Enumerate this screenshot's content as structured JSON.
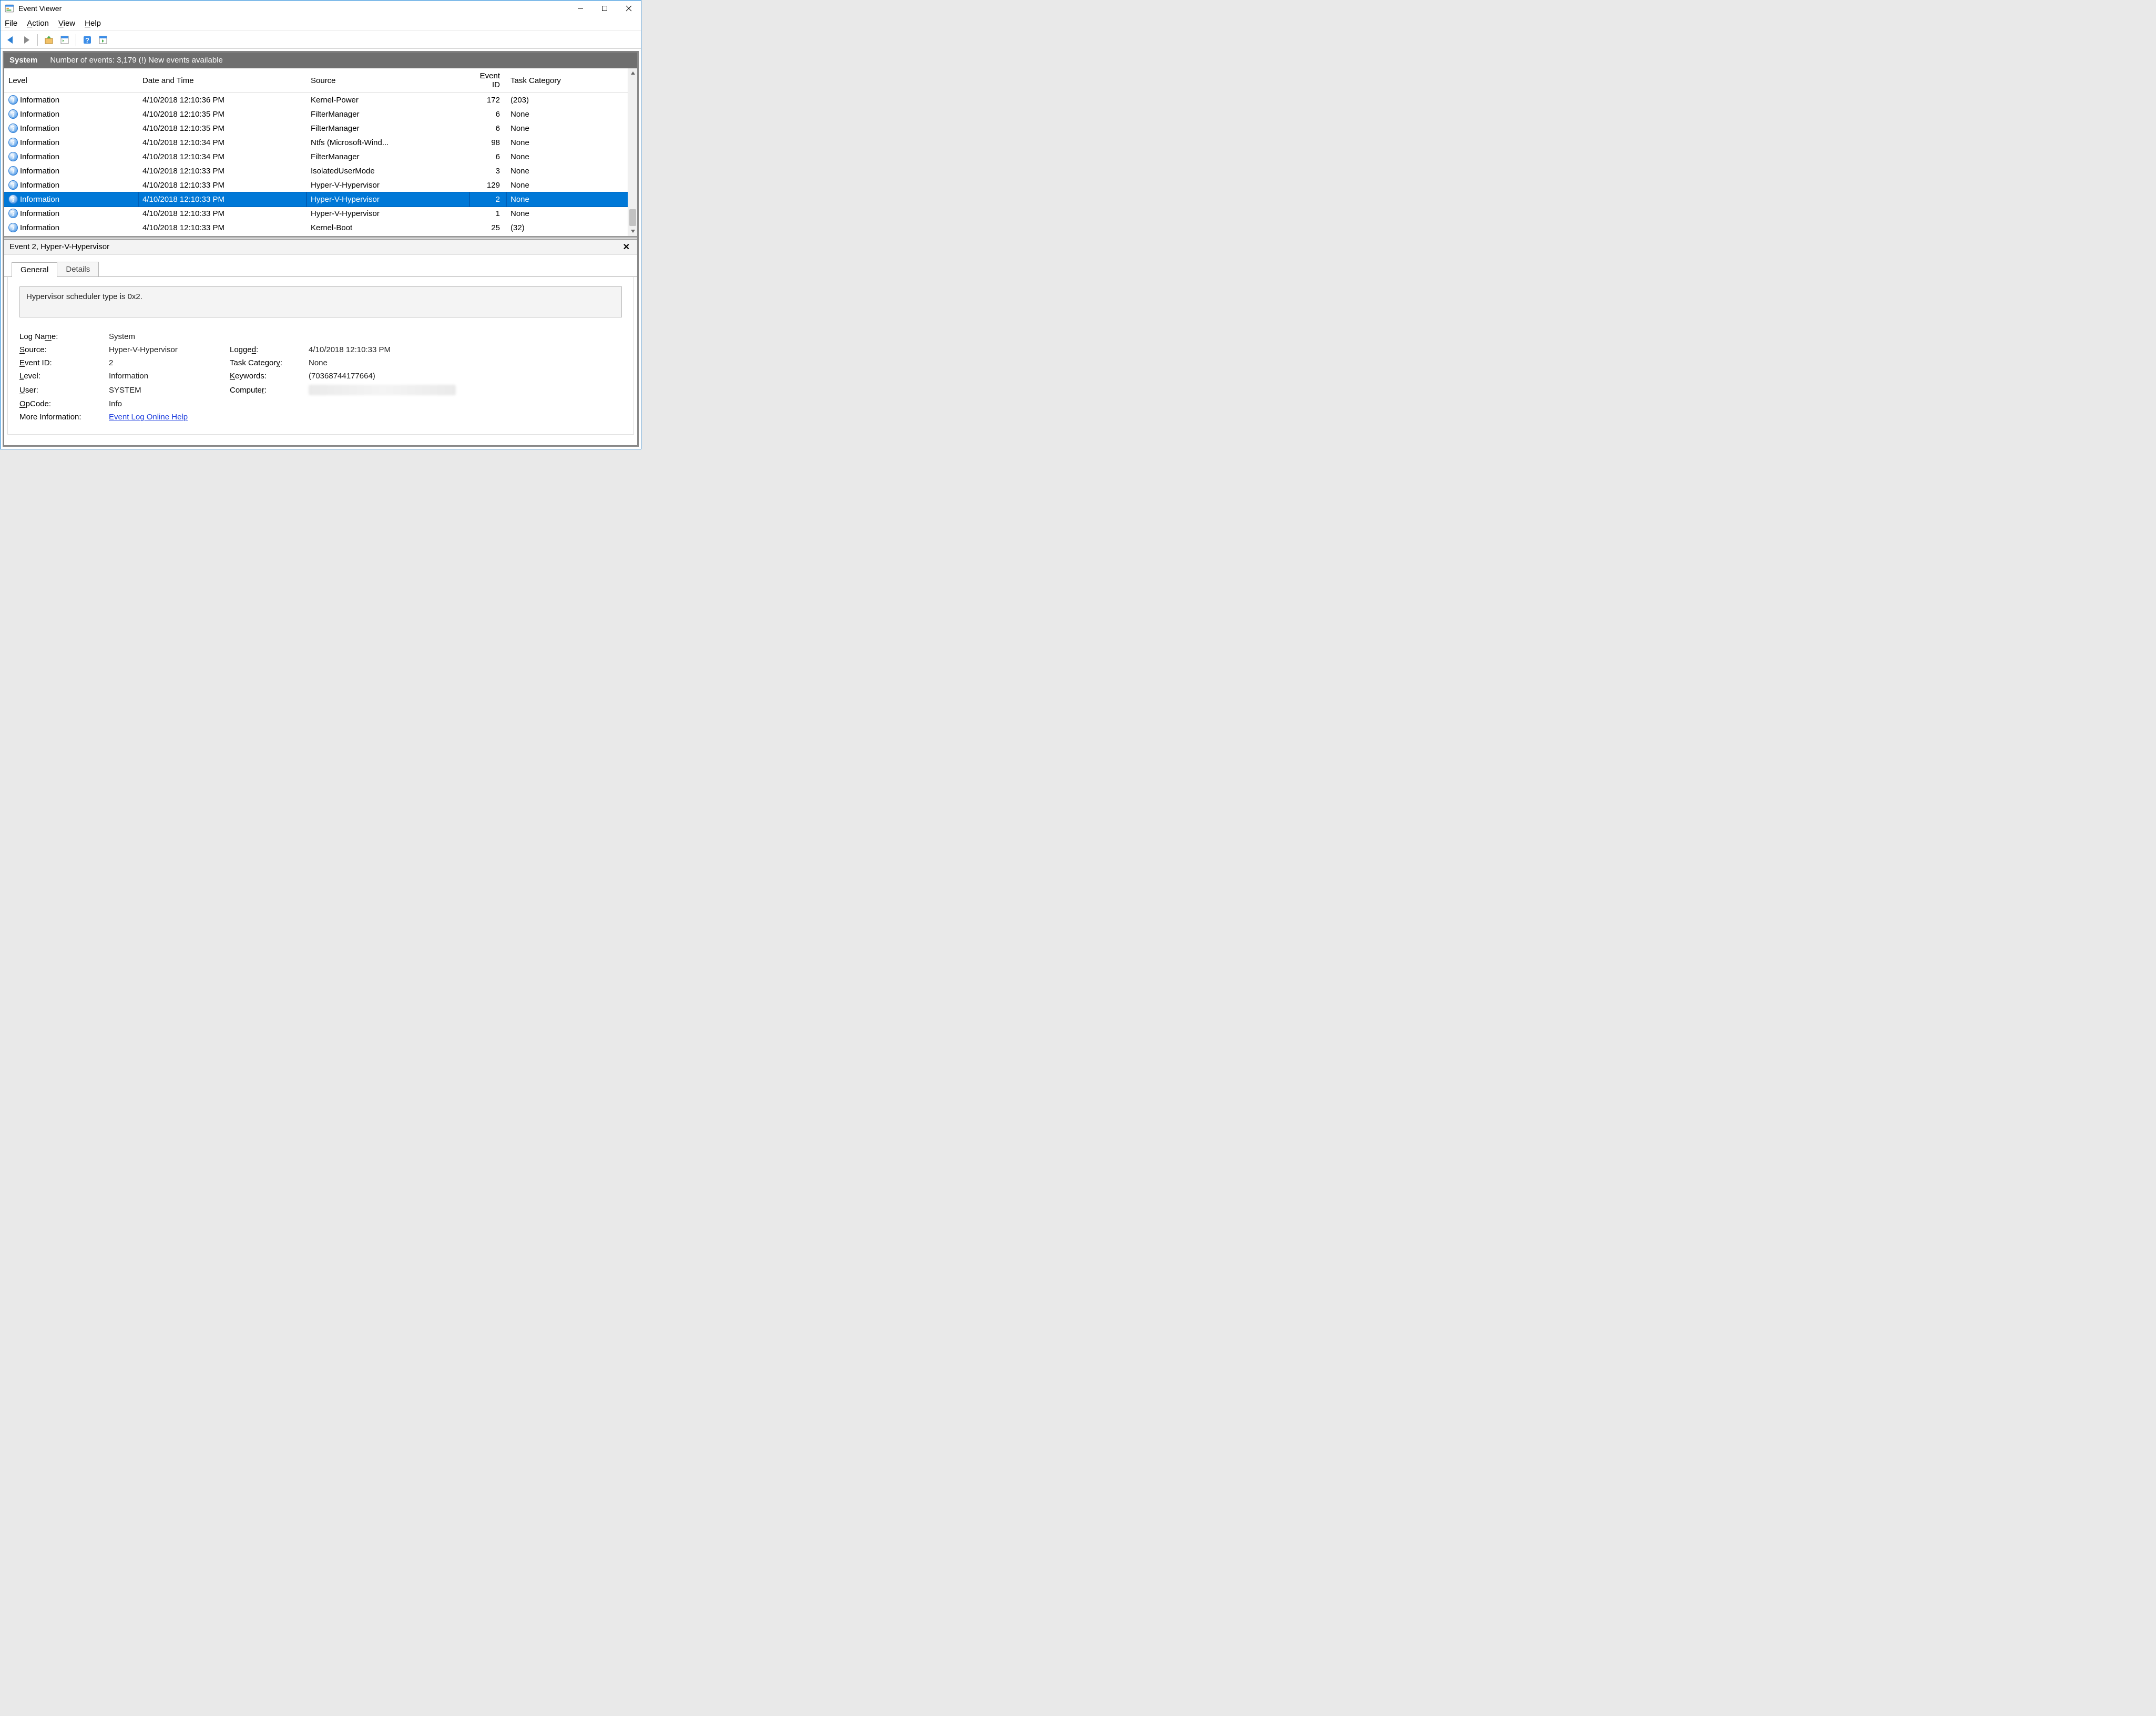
{
  "window": {
    "title": "Event Viewer"
  },
  "menu": {
    "file": "File",
    "action": "Action",
    "view": "View",
    "help": "Help"
  },
  "darkbar": {
    "title": "System",
    "count_text": "Number of events: 3,179 (!) New events available"
  },
  "grid": {
    "headers": {
      "level": "Level",
      "dt": "Date and Time",
      "src": "Source",
      "eid": "Event ID",
      "task": "Task Category"
    },
    "rows": [
      {
        "level": "Information",
        "dt": "4/10/2018 12:10:36 PM",
        "src": "Kernel-Power",
        "eid": "172",
        "task": "(203)",
        "selected": false
      },
      {
        "level": "Information",
        "dt": "4/10/2018 12:10:35 PM",
        "src": "FilterManager",
        "eid": "6",
        "task": "None",
        "selected": false
      },
      {
        "level": "Information",
        "dt": "4/10/2018 12:10:35 PM",
        "src": "FilterManager",
        "eid": "6",
        "task": "None",
        "selected": false
      },
      {
        "level": "Information",
        "dt": "4/10/2018 12:10:34 PM",
        "src": "Ntfs (Microsoft-Wind...",
        "eid": "98",
        "task": "None",
        "selected": false
      },
      {
        "level": "Information",
        "dt": "4/10/2018 12:10:34 PM",
        "src": "FilterManager",
        "eid": "6",
        "task": "None",
        "selected": false
      },
      {
        "level": "Information",
        "dt": "4/10/2018 12:10:33 PM",
        "src": "IsolatedUserMode",
        "eid": "3",
        "task": "None",
        "selected": false
      },
      {
        "level": "Information",
        "dt": "4/10/2018 12:10:33 PM",
        "src": "Hyper-V-Hypervisor",
        "eid": "129",
        "task": "None",
        "selected": false
      },
      {
        "level": "Information",
        "dt": "4/10/2018 12:10:33 PM",
        "src": "Hyper-V-Hypervisor",
        "eid": "2",
        "task": "None",
        "selected": true
      },
      {
        "level": "Information",
        "dt": "4/10/2018 12:10:33 PM",
        "src": "Hyper-V-Hypervisor",
        "eid": "1",
        "task": "None",
        "selected": false
      },
      {
        "level": "Information",
        "dt": "4/10/2018 12:10:33 PM",
        "src": "Kernel-Boot",
        "eid": "25",
        "task": "(32)",
        "selected": false
      }
    ]
  },
  "detail": {
    "header": "Event 2, Hyper-V-Hypervisor",
    "tabs": {
      "general": "General",
      "details": "Details"
    },
    "message": "Hypervisor scheduler type is 0x2.",
    "props": {
      "log_name_label": "Log Name:",
      "log_name": "System",
      "source_label": "Source:",
      "source": "Hyper-V-Hypervisor",
      "logged_label": "Logged:",
      "logged": "4/10/2018 12:10:33 PM",
      "eventid_label": "Event ID:",
      "eventid": "2",
      "taskcat_label": "Task Category:",
      "taskcat": "None",
      "level_label": "Level:",
      "level": "Information",
      "keywords_label": "Keywords:",
      "keywords": "(70368744177664)",
      "user_label": "User:",
      "user": "SYSTEM",
      "computer_label": "Computer:",
      "opcode_label": "OpCode:",
      "opcode": "Info",
      "moreinfo_label": "More Information:",
      "moreinfo_link": "Event Log Online Help"
    }
  }
}
